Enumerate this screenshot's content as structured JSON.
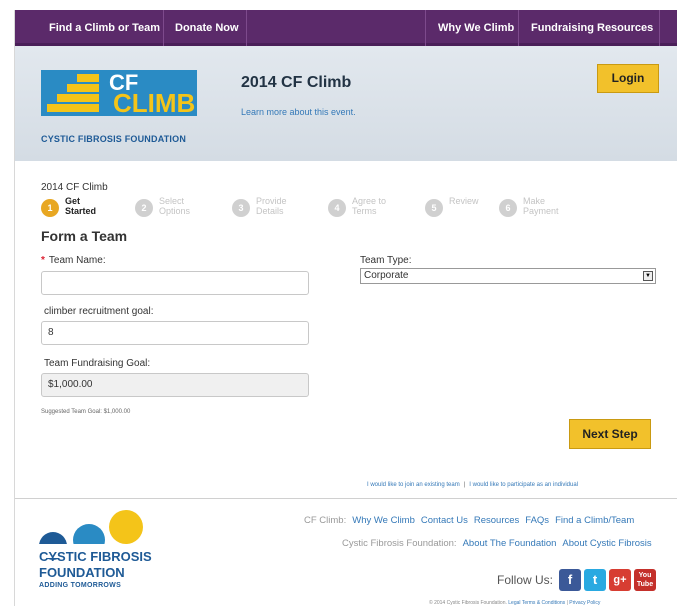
{
  "nav": {
    "items": [
      "Find a Climb or Team",
      "Donate Now",
      "Why We Climb",
      "Fundraising Resources"
    ]
  },
  "header": {
    "logo_cf": "CF",
    "logo_climb": "CLIMB",
    "logo_foundation": "CYSTIC FIBROSIS FOUNDATION",
    "event_title": "2014 CF Climb",
    "event_link": "Learn more about this event.",
    "login_label": "Login"
  },
  "steps": {
    "breadcrumb": "2014 CF Climb",
    "items": [
      {
        "num": "1",
        "label": "Get\nStarted"
      },
      {
        "num": "2",
        "label": "Select\nOptions"
      },
      {
        "num": "3",
        "label": "Provide\nDetails"
      },
      {
        "num": "4",
        "label": "Agree to\nTerms"
      },
      {
        "num": "5",
        "label": "Review"
      },
      {
        "num": "6",
        "label": "Make\nPayment"
      }
    ],
    "active_index": 0
  },
  "form": {
    "title": "Form a Team",
    "required_mark": "*",
    "team_name_label": "Team Name:",
    "team_name_value": "",
    "team_type_label": "Team Type:",
    "team_type_value": "Corporate",
    "recruit_label": "climber recruitment goal:",
    "recruit_value": "8",
    "fund_label": "Team Fundraising Goal:",
    "fund_value": "$1,000.00",
    "hint": "Suggested Team Goal: $1,000.00",
    "next_label": "Next Step",
    "join_team": "I would like to join an existing team",
    "join_sep": "|",
    "join_individual": "I would like to participate as an individual"
  },
  "footer": {
    "logo_line1": "CYSTIC FIBROSIS",
    "logo_line2": "FOUNDATION",
    "logo_line3": "ADDING TOMORROWS",
    "row1_prefix": "CF Climb:",
    "row1_links": [
      "Why We Climb",
      "Contact Us",
      "Resources",
      "FAQs",
      "Find a Climb/Team"
    ],
    "row2_prefix": "Cystic Fibrosis Foundation:",
    "row2_links": [
      "About The Foundation",
      "About Cystic Fibrosis"
    ],
    "follow_label": "Follow Us:",
    "social": [
      {
        "icon": "facebook-icon",
        "glyph": "f",
        "color": "#3b5998"
      },
      {
        "icon": "twitter-icon",
        "glyph": "t",
        "color": "#29a9e1"
      },
      {
        "icon": "google-plus-icon",
        "glyph": "g+",
        "color": "#d73d32"
      },
      {
        "icon": "youtube-icon",
        "glyph": "You\nTube",
        "color": "#c4302b"
      }
    ],
    "copyright": "© 2014 Cystic Fibrosis Foundation.",
    "legal_link": "Legal Terms & Conditions",
    "privacy_link": "Privacy Policy",
    "legal_sep": "|"
  }
}
